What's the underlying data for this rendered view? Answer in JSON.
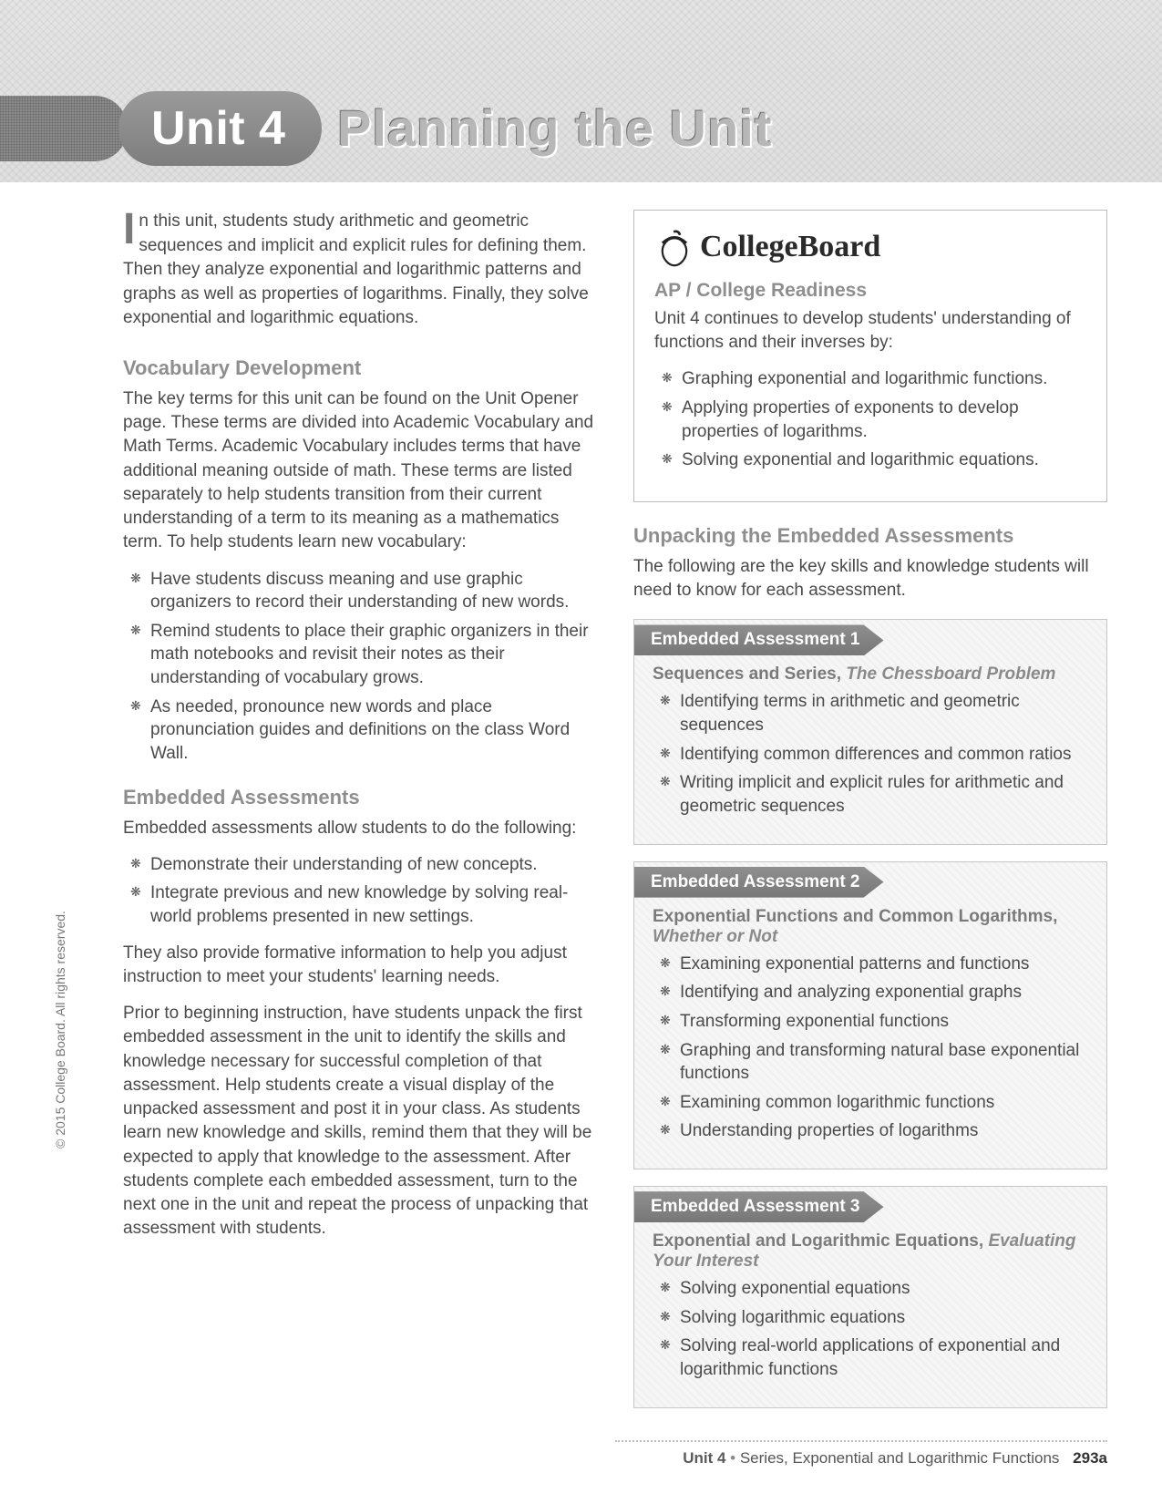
{
  "banner": {
    "unit_label": "Unit 4",
    "title": "Planning the Unit"
  },
  "left": {
    "intro_first": "I",
    "intro_rest": "n this unit, students study arithmetic and geometric sequences and implicit and explicit rules for defining them. Then they analyze exponential and logarithmic patterns and graphs as well as properties of logarithms. Finally, they solve exponential and logarithmic equations.",
    "vocab_heading": "Vocabulary Development",
    "vocab_text": "The key terms for this unit can be found on the Unit Opener page. These terms are divided into Academic Vocabulary and Math Terms. Academic Vocabulary includes terms that have additional meaning outside of math. These terms are listed separately to help students transition from their current understanding of a term to its meaning as a mathematics term. To help students learn new vocabulary:",
    "vocab_bullets": [
      "Have students discuss meaning and use graphic organizers to record their understanding of new words.",
      "Remind students to place their graphic organizers in their math notebooks and revisit their notes as their understanding of vocabulary grows.",
      "As needed, pronounce new words and place pronunciation guides and definitions on the class Word Wall."
    ],
    "ea_heading": "Embedded Assessments",
    "ea_text1": "Embedded assessments allow students to do the following:",
    "ea_bullets": [
      "Demonstrate their understanding of new concepts.",
      "Integrate previous and new knowledge by solving real-world problems presented in new settings."
    ],
    "ea_text2": "They also provide formative information to help you adjust instruction to meet your students' learning needs.",
    "ea_text3": "Prior to beginning instruction, have students unpack the first embedded assessment in the unit to identify the skills and knowledge necessary for successful completion of that assessment. Help students create a visual display of the unpacked assessment and post it in your class. As students learn new knowledge and skills, remind them that they will be expected to apply that knowledge to the assessment. After students complete each embedded assessment, turn to the next one in the unit and repeat the process of unpacking that assessment with students."
  },
  "right": {
    "cb_word": "CollegeBoard",
    "ap_heading": "AP / College Readiness",
    "ap_text": "Unit 4 continues to develop students' understanding of functions and their inverses by:",
    "ap_bullets": [
      "Graphing exponential and logarithmic functions.",
      "Applying properties of exponents to develop properties of logarithms.",
      "Solving exponential and logarithmic equations."
    ],
    "unpack_heading": "Unpacking the Embedded Assessments",
    "unpack_text": "The following are the key skills and knowledge students will need to know for each assessment.",
    "ea1": {
      "tab": "Embedded Assessment 1",
      "title": "Sequences and Series,",
      "subtitle": "The Chessboard Problem",
      "bullets": [
        "Identifying terms in arithmetic and geometric sequences",
        "Identifying common differences and common ratios",
        "Writing implicit and explicit rules for arithmetic and geometric sequences"
      ]
    },
    "ea2": {
      "tab": "Embedded Assessment 2",
      "title": "Exponential Functions and Common Logarithms,",
      "subtitle": "Whether or Not",
      "bullets": [
        "Examining exponential patterns and functions",
        "Identifying and analyzing exponential graphs",
        "Transforming exponential functions",
        "Graphing and transforming natural base exponential functions",
        "Examining common logarithmic functions",
        "Understanding properties of logarithms"
      ]
    },
    "ea3": {
      "tab": "Embedded Assessment 3",
      "title": "Exponential and Logarithmic Equations,",
      "subtitle": "Evaluating Your Interest",
      "bullets": [
        "Solving exponential equations",
        "Solving logarithmic equations",
        "Solving real-world applications of exponential and logarithmic functions"
      ]
    }
  },
  "footer": {
    "unit": "Unit 4",
    "sep": "•",
    "title": "Series, Exponential and Logarithmic Functions",
    "page": "293a"
  },
  "copyright": "© 2015 College Board. All rights reserved."
}
